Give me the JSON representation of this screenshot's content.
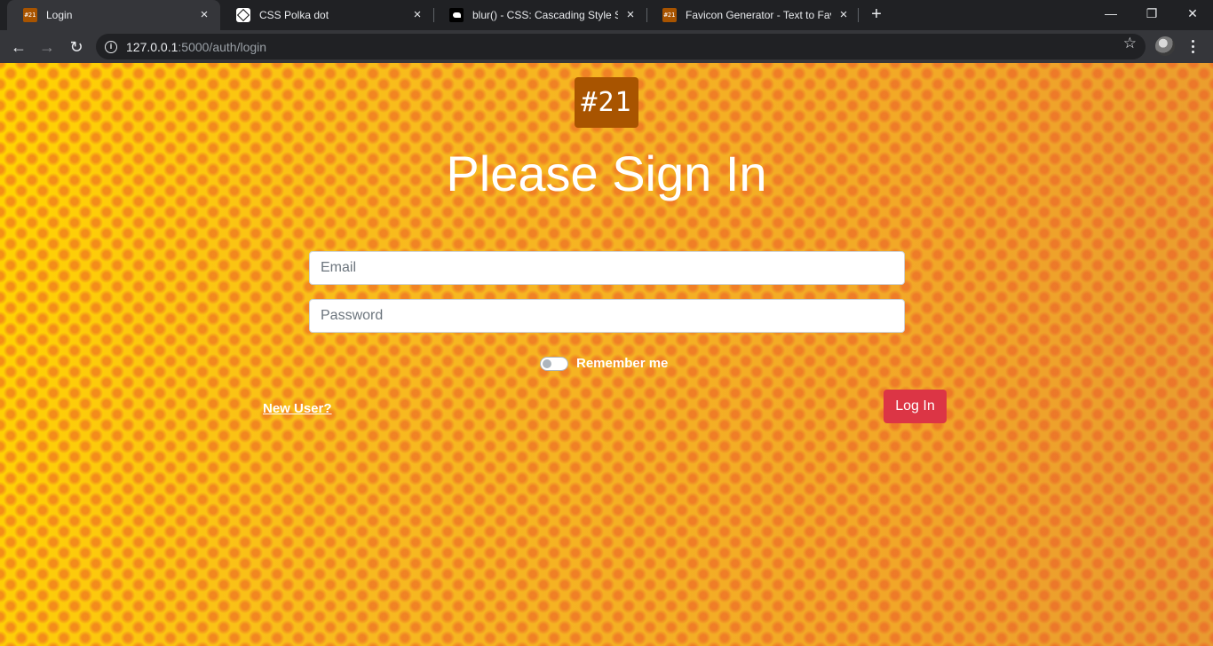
{
  "browser": {
    "tabs": [
      {
        "title": "Login",
        "favicon": "badge-21-icon",
        "active": true
      },
      {
        "title": "CSS Polka dot",
        "favicon": "codepen-icon",
        "active": false
      },
      {
        "title": "blur() - CSS: Cascading Style Shee",
        "favicon": "mdn-icon",
        "active": false
      },
      {
        "title": "Favicon Generator - Text to Favico",
        "favicon": "badge-21-icon",
        "active": false
      }
    ],
    "favicon_text": "#21",
    "new_tab": "+",
    "address": {
      "host": "127.0.0.1",
      "path": ":5000/auth/login"
    },
    "controls": {
      "minimize": "—",
      "restore": "❐",
      "close": "✕"
    }
  },
  "page": {
    "logo_text": "#21",
    "heading": "Please Sign In",
    "email_placeholder": "Email",
    "password_placeholder": "Password",
    "remember_label": "Remember me",
    "remember_checked": false,
    "new_user_link": "New User?",
    "login_button": "Log In",
    "colors": {
      "background_base": "#f6b820",
      "polka_dot": "#ec5828",
      "logo_bg": "#a85400",
      "login_button": "#dc3545"
    }
  }
}
